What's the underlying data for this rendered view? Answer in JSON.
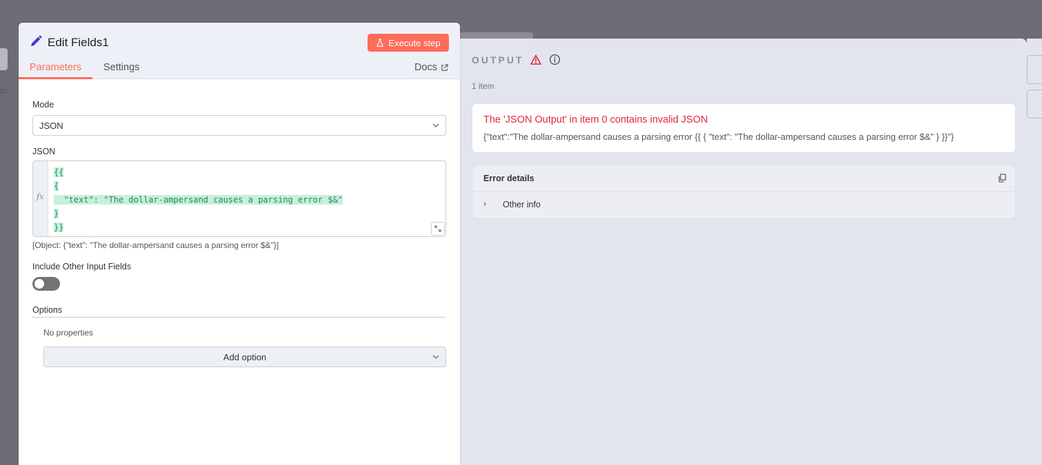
{
  "background": {
    "left_text": "m"
  },
  "edit_panel": {
    "title": "Edit Fields1",
    "execute_label": "Execute step",
    "tabs": [
      {
        "label": "Parameters",
        "active": true
      },
      {
        "label": "Settings",
        "active": false
      }
    ],
    "docs_label": "Docs",
    "mode": {
      "label": "Mode",
      "value": "JSON"
    },
    "json": {
      "label": "JSON",
      "lines": [
        "{{",
        "{",
        "  \"text\": \"The dollar-ampersand causes a parsing error $&\"",
        "}",
        "}}"
      ],
      "result_hint": "[Object: {\"text\": \"The dollar-ampersand causes a parsing error $&\"}]"
    },
    "include_other": {
      "label": "Include Other Input Fields",
      "on": false
    },
    "options": {
      "label": "Options",
      "empty_text": "No properties",
      "add_label": "Add option"
    }
  },
  "output_panel": {
    "title": "OUTPUT",
    "item_count": "1 item",
    "error": {
      "title": "The 'JSON Output' in item 0 contains invalid JSON",
      "message": "{\"text\":\"The dollar-ampersand causes a parsing error {{ { \"text\": \"The dollar-ampersand causes a parsing error $&\" } }}\"}"
    },
    "details": {
      "title": "Error details",
      "other_info_label": "Other info"
    }
  },
  "colors": {
    "accent": "#ff6d5a",
    "error": "#e0293a",
    "code_green": "#1d8f57",
    "code_highlight": "#c8efdb"
  }
}
